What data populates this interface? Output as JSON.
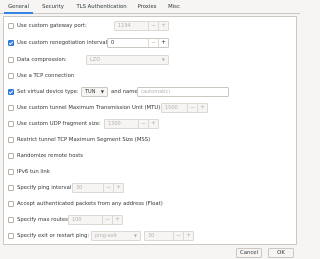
{
  "tabs": [
    "General",
    "Security",
    "TLS Authentication",
    "Proxies",
    "Misc"
  ],
  "options": {
    "gateway_port": {
      "label": "Use custom gateway port:",
      "value": "1194",
      "checked": false
    },
    "reneg": {
      "label": "Use custom renegotiation interval:",
      "value": "0",
      "checked": true
    },
    "compression": {
      "label": "Data compression:",
      "value": "LZO",
      "checked": false
    },
    "tcp": {
      "label": "Use a TCP connection",
      "checked": false
    },
    "virtual_device": {
      "label": "Set virtual device type:",
      "type_value": "TUN",
      "name_label": "and name:",
      "name_placeholder": "(automatic)",
      "checked": true
    },
    "mtu": {
      "label": "Use custom tunnel Maximum Transmission Unit (MTU):",
      "value": "1500",
      "checked": false
    },
    "udp_frag": {
      "label": "Use custom UDP fragment size:",
      "value": "1300",
      "checked": false
    },
    "mss": {
      "label": "Restrict tunnel TCP Maximum Segment Size (MSS)",
      "checked": false
    },
    "randomize": {
      "label": "Randomize remote hosts",
      "checked": false
    },
    "ipv6": {
      "label": "IPv6 tun link",
      "checked": false
    },
    "ping": {
      "label": "Specify ping interval:",
      "value": "30",
      "checked": false
    },
    "float": {
      "label": "Accept authenticated packets from any address (Float)",
      "checked": false
    },
    "max_routes": {
      "label": "Specify max routes:",
      "value": "100",
      "checked": false
    },
    "exit_restart": {
      "label": "Specify exit or restart ping:",
      "type_value": "ping-exit",
      "value": "30",
      "checked": false
    }
  },
  "footer": {
    "cancel_label": "Cancel",
    "ok_label": "OK"
  }
}
